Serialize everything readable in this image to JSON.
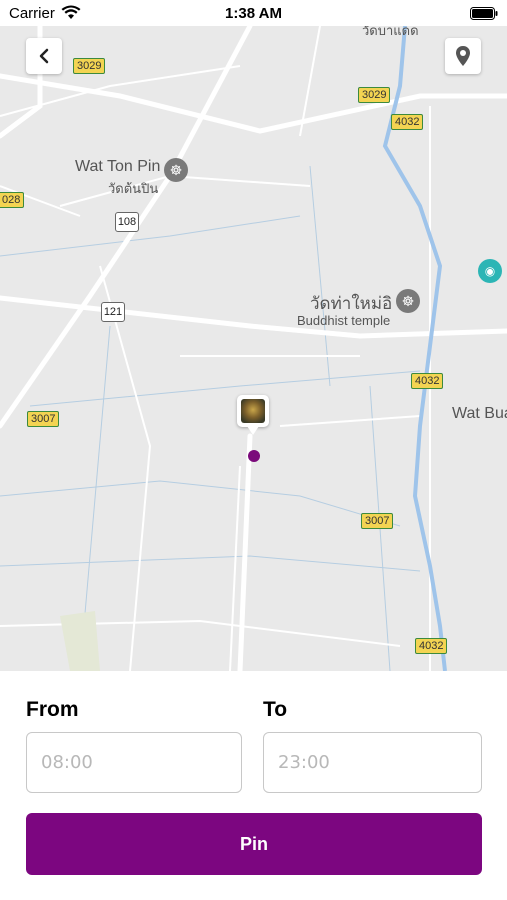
{
  "status_bar": {
    "carrier": "Carrier",
    "time": "1:38 AM"
  },
  "map": {
    "road_shields": [
      "3029",
      "3029",
      "4032",
      "028",
      "3007",
      "4032",
      "3007",
      "4032"
    ],
    "road_markers": [
      "108",
      "121"
    ],
    "labels": {
      "wat_ton_pin_en": "Wat Ton Pin",
      "wat_ton_pin_th": "วัดต้นปิน",
      "wat_tha_mai_th": "วัดท่าใหม่อิ",
      "buddhist_temple": "Buddhist temple",
      "wat_bua": "Wat Bua",
      "top_thai": "วัดบาแดด"
    },
    "icons": {
      "back": "chevron-left-icon",
      "location": "location-pin-icon",
      "temple": "temple-icon",
      "camera": "camera-icon"
    },
    "colors": {
      "land": "#e9e9e9",
      "road": "#ffffff",
      "water": "#a8c8e8",
      "accent": "#7c0680"
    }
  },
  "form": {
    "from_label": "From",
    "to_label": "To",
    "from_placeholder": "08:00",
    "to_placeholder": "23:00",
    "pin_label": "Pin"
  }
}
